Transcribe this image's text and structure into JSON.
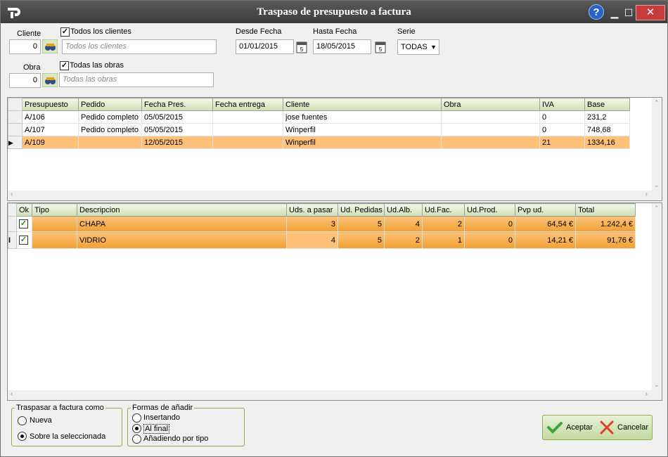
{
  "window": {
    "title": "Traspaso de presupuesto a factura",
    "help": "?",
    "min": "▁",
    "max": "☐",
    "close": "✕"
  },
  "filters": {
    "cliente_label": "Cliente",
    "cliente_value": "0",
    "todos_clientes_label": "Todos los clientes",
    "todos_clientes_checked": true,
    "cliente_placeholder": "Todos los clientes",
    "obra_label": "Obra",
    "obra_value": "0",
    "todas_obras_label": "Todas las obras",
    "todas_obras_checked": true,
    "obra_placeholder": "Todas las obras",
    "desde_label": "Desde Fecha",
    "desde_value": "01/01/2015",
    "hasta_label": "Hasta Fecha",
    "hasta_value": "18/05/2015",
    "serie_label": "Serie",
    "serie_value": "TODAS"
  },
  "presupuestos": {
    "headers": [
      "Presupuesto",
      "Pedido",
      "Fecha Pres.",
      "Fecha entrega",
      "Cliente",
      "Obra",
      "IVA",
      "Base"
    ],
    "rows": [
      [
        "A/106",
        "Pedido completo",
        "05/05/2015",
        "",
        "jose fuentes",
        "",
        "0",
        "231,2"
      ],
      [
        "A/107",
        "Pedido completo",
        "05/05/2015",
        "",
        "Winperfil",
        "",
        "0",
        "748,68"
      ],
      [
        "A/109",
        "",
        "12/05/2015",
        "",
        "Winperfil",
        "",
        "21",
        "1334,16"
      ]
    ],
    "selected_row": 2
  },
  "lineas": {
    "headers": [
      "Ok",
      "Tipo",
      "Descripcion",
      "Uds. a pasar",
      "Ud. Pedidas",
      "Ud.Alb.",
      "Ud.Fac.",
      "Ud.Prod.",
      "Pvp ud.",
      "Total"
    ],
    "rows": [
      [
        "✓",
        "",
        "CHAPA",
        "3",
        "5",
        "4",
        "2",
        "0",
        "64,54 €",
        "1.242,4 €"
      ],
      [
        "✓",
        "",
        "VIDRIO",
        "4",
        "5",
        "2",
        "1",
        "0",
        "14,21 €",
        "91,76 €"
      ]
    ]
  },
  "traspasar": {
    "title": "Traspasar a factura como",
    "options": [
      "Nueva",
      "Sobre la seleccionada"
    ],
    "selected": 1
  },
  "formas": {
    "title": "Formas de añadir",
    "options": [
      "Insertando",
      "Al final",
      "Añadiendo por tipo"
    ],
    "selected": 1
  },
  "actions": {
    "accept": "Aceptar",
    "cancel": "Cancelar"
  }
}
